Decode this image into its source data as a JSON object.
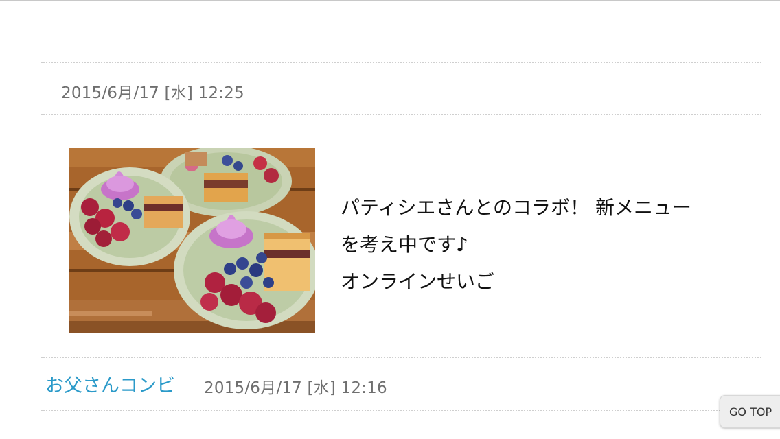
{
  "post1": {
    "date": "2015/6月/17 [水] 12:25",
    "body_lines": [
      "パティシエさんとのコラボ！ 新メニュー",
      "を考え中です♪",
      "オンラインせいご"
    ]
  },
  "post2": {
    "title": "お父さんコンビ",
    "date": "2015/6月/17 [水] 12:16"
  },
  "go_top_label": "GO TOP",
  "colors": {
    "link": "#2b9ac9",
    "meta_text": "#6f6f6f",
    "rule": "#cfcfcf"
  },
  "icons": {
    "photo": "dessert-photo"
  }
}
